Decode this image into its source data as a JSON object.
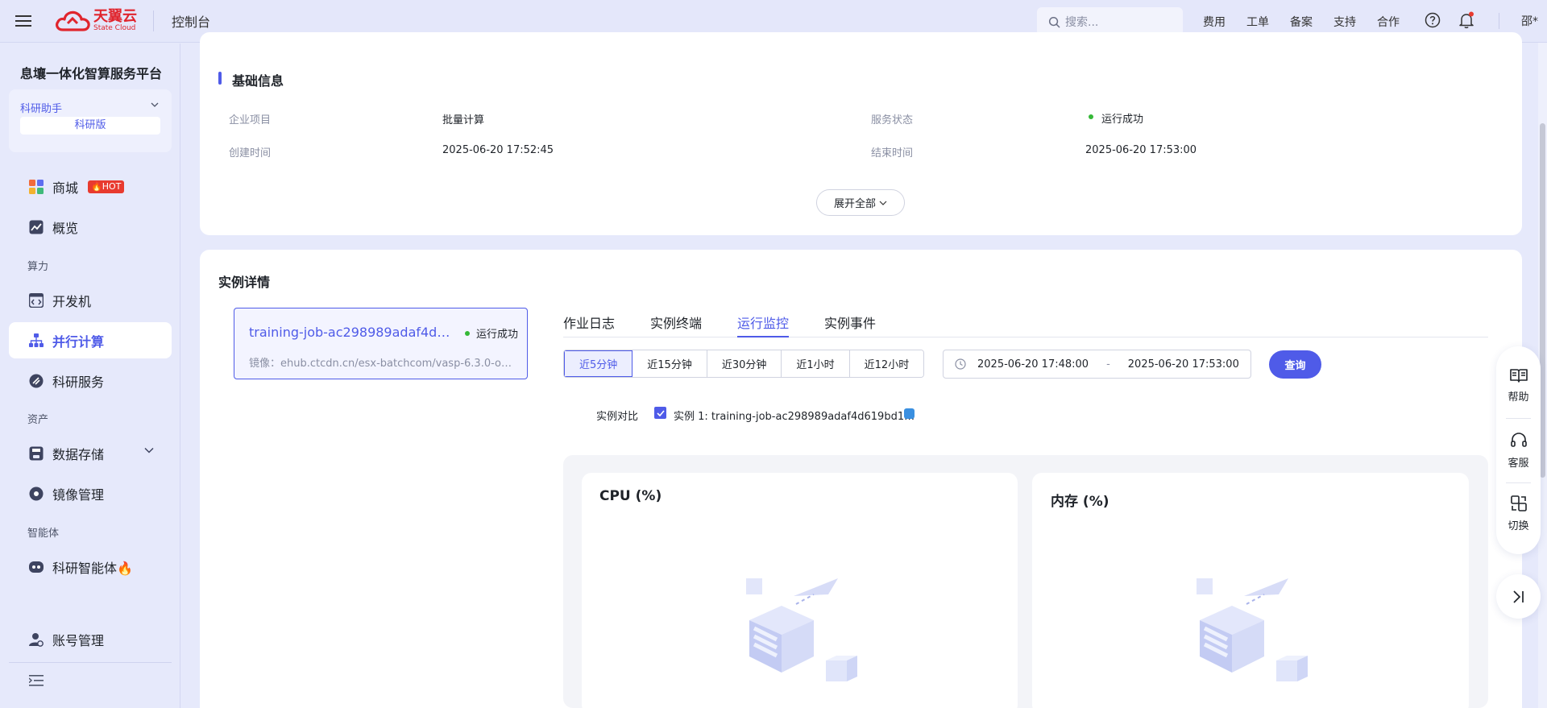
{
  "header": {
    "logo_cn": "天翼云",
    "logo_en": "State Cloud",
    "console": "控制台",
    "search_placeholder": "搜索...",
    "nav": [
      "费用",
      "工单",
      "备案",
      "支持",
      "合作"
    ],
    "user": "邵*"
  },
  "sidebar": {
    "platform_title": "息壤一体化智算服务平台",
    "assistant_label": "科研助手",
    "edition": "科研版",
    "items": [
      {
        "label": "商城",
        "icon": "shop-icon",
        "badge": "HOT"
      },
      {
        "label": "概览",
        "icon": "chart-icon"
      },
      {
        "label": "开发机",
        "icon": "code-icon"
      },
      {
        "label": "并行计算",
        "icon": "cluster-icon",
        "active": true
      },
      {
        "label": "科研服务",
        "icon": "research-icon"
      },
      {
        "label": "数据存储",
        "icon": "storage-icon"
      },
      {
        "label": "镜像管理",
        "icon": "image-icon"
      },
      {
        "label": "科研智能体🔥",
        "icon": "agent-icon"
      },
      {
        "label": "账号管理",
        "icon": "account-icon"
      }
    ],
    "sections": [
      "算力",
      "资产",
      "智能体"
    ]
  },
  "basic_info": {
    "title": "基础信息",
    "fields": [
      {
        "label": "企业项目",
        "value": "批量计算"
      },
      {
        "label": "服务状态",
        "value": "运行成功"
      },
      {
        "label": "创建时间",
        "value": "2025-06-20 17:52:45"
      },
      {
        "label": "结束时间",
        "value": "2025-06-20 17:53:00"
      }
    ],
    "expand_label": "展开全部"
  },
  "instance_detail": {
    "title": "实例详情",
    "instance": {
      "name": "training-job-ac298989adaf4d61…",
      "status": "运行成功",
      "image": "镜像：ehub.ctcdn.cn/esx-batchcom/vasp-6.3.0-op…"
    },
    "tabs": [
      "作业日志",
      "实例终端",
      "运行监控",
      "实例事件"
    ],
    "active_tab": 2,
    "time_ranges": [
      "近5分钟",
      "近15分钟",
      "近30分钟",
      "近1小时",
      "近12小时"
    ],
    "active_range": 0,
    "date_start": "2025-06-20 17:48:00",
    "date_sep": "-",
    "date_end": "2025-06-20 17:53:00",
    "query_label": "查询",
    "compare_label": "实例对比",
    "compare_instance": "实例 1: training-job-ac298989adaf4d619bd1…",
    "compare_color": "#3a8fe0",
    "charts": [
      {
        "title": "CPU (%)"
      },
      {
        "title": "内存 (%)"
      }
    ]
  },
  "float_panel": {
    "items": [
      {
        "label": "帮助",
        "icon": "book-icon"
      },
      {
        "label": "客服",
        "icon": "headset-icon"
      },
      {
        "label": "切换",
        "icon": "switch-icon"
      }
    ]
  },
  "colors": {
    "accent": "#4f5be8",
    "brand": "#e0252d",
    "success": "#35b837"
  }
}
